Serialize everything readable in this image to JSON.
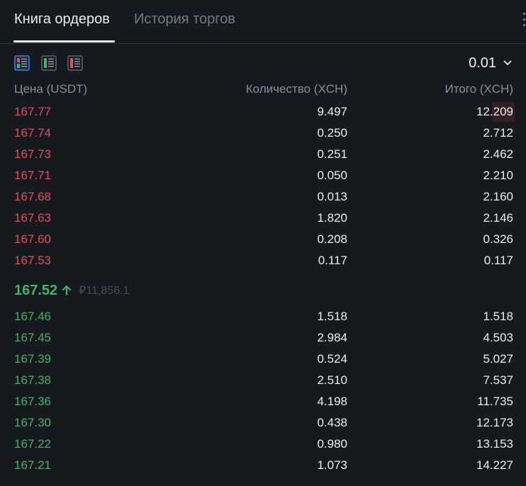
{
  "tabs": [
    {
      "label": "Книга ордеров",
      "active": true
    },
    {
      "label": "История торгов",
      "active": false
    }
  ],
  "toolbar": {
    "precision": "0.01",
    "views": [
      {
        "name": "both",
        "selected": true
      },
      {
        "name": "bids",
        "selected": false
      },
      {
        "name": "asks",
        "selected": false
      }
    ]
  },
  "headers": {
    "price": "Цена (USDT)",
    "quantity": "Количество (XCH)",
    "total": "Итого (XCH)"
  },
  "colors": {
    "ask": "#e0505e",
    "bid": "#3fb56a",
    "text": "#eaecef",
    "muted": "#848e9c",
    "background": "#161a1e",
    "accent": "#3b82f6"
  },
  "asks": [
    {
      "price": "167.77",
      "qty": "9.497",
      "total": "12.209"
    },
    {
      "price": "167.74",
      "qty": "0.250",
      "total": "2.712"
    },
    {
      "price": "167.73",
      "qty": "0.251",
      "total": "2.462"
    },
    {
      "price": "167.71",
      "qty": "0.050",
      "total": "2.210"
    },
    {
      "price": "167.68",
      "qty": "0.013",
      "total": "2.160"
    },
    {
      "price": "167.63",
      "qty": "1.820",
      "total": "2.146"
    },
    {
      "price": "167.60",
      "qty": "0.208",
      "total": "0.326"
    },
    {
      "price": "167.53",
      "qty": "0.117",
      "total": "0.117"
    }
  ],
  "mid": {
    "price": "167.52",
    "direction_icon": "arrow-up-icon",
    "fiat": "₽11,856.1"
  },
  "bids": [
    {
      "price": "167.46",
      "qty": "1.518",
      "total": "1.518"
    },
    {
      "price": "167.45",
      "qty": "2.984",
      "total": "4.503"
    },
    {
      "price": "167.39",
      "qty": "0.524",
      "total": "5.027"
    },
    {
      "price": "167.38",
      "qty": "2.510",
      "total": "7.537"
    },
    {
      "price": "167.36",
      "qty": "4.198",
      "total": "11.735"
    },
    {
      "price": "167.30",
      "qty": "0.438",
      "total": "12.173"
    },
    {
      "price": "167.22",
      "qty": "0.980",
      "total": "13.153"
    },
    {
      "price": "167.21",
      "qty": "1.073",
      "total": "14.227"
    }
  ]
}
